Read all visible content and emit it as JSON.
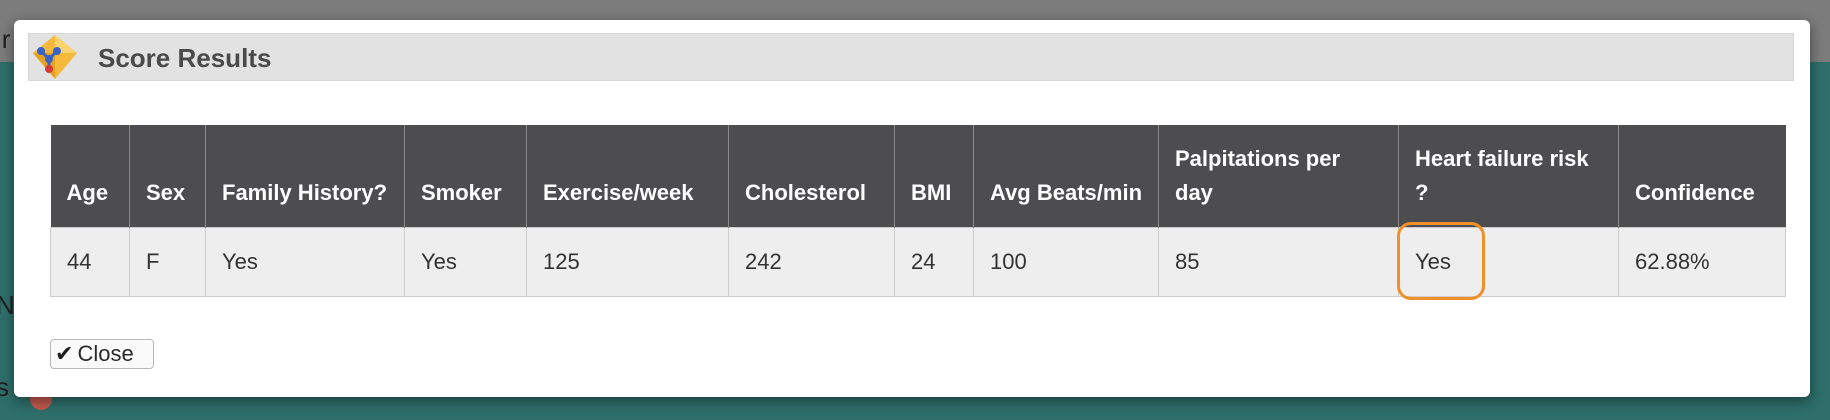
{
  "background": {
    "fragment_1": "ir",
    "fragment_2": "N",
    "fragment_3": "s"
  },
  "dialog": {
    "title": "Score Results",
    "close_label": "Close",
    "close_icon": "checkmark-icon",
    "logo_icon": "diamond-molecule-logo"
  },
  "table": {
    "headers": [
      "Age",
      "Sex",
      "Family History?",
      "Smoker",
      "Exercise/week",
      "Cholesterol",
      "BMI",
      "Avg Beats/min",
      "Palpitations per day",
      "Heart failure risk ?",
      "Confidence"
    ],
    "rows": [
      [
        "44",
        "F",
        "Yes",
        "Yes",
        "125",
        "242",
        "24",
        "100",
        "85",
        "Yes",
        "62.88%"
      ]
    ],
    "highlighted_cell": "Heart failure risk ?"
  },
  "colors": {
    "header_bg": "#4d4d50",
    "highlight": "#f0902a",
    "title_bar": "#e2e2e2",
    "backdrop": "#2e6f6b"
  }
}
